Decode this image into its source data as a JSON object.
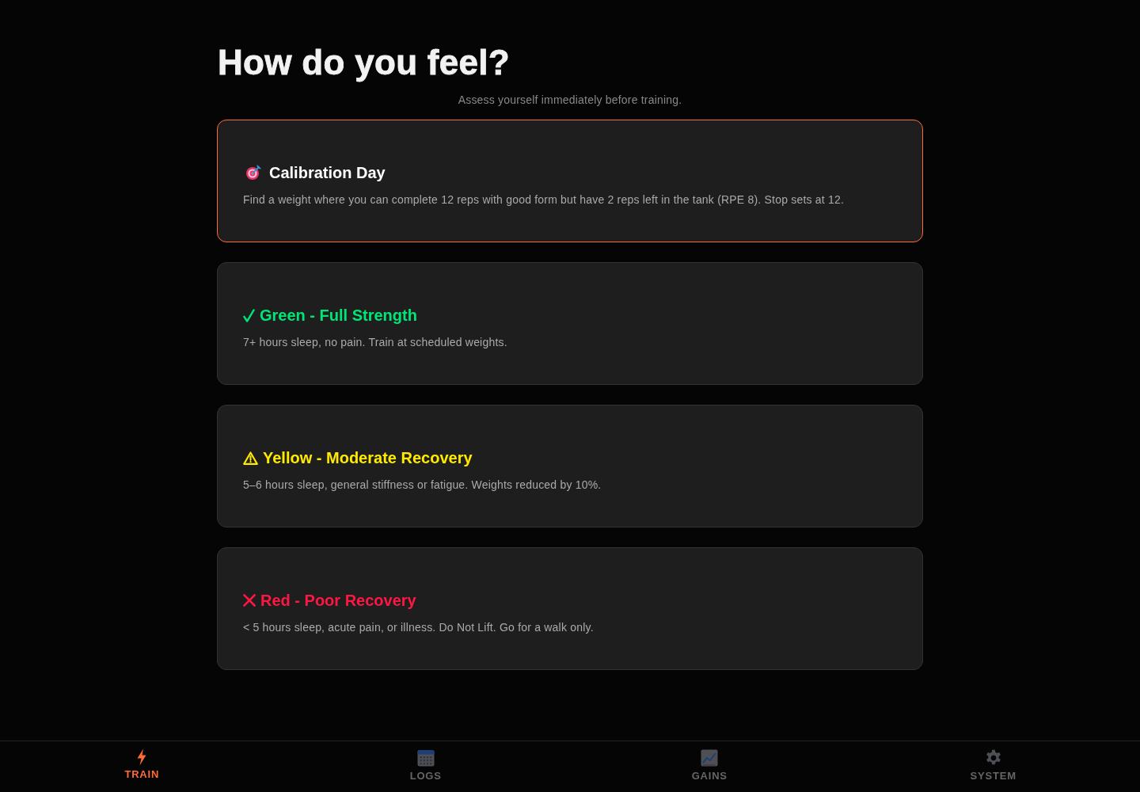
{
  "header": {
    "title": "How do you feel?",
    "subtitle": "Assess yourself immediately before training."
  },
  "cards": [
    {
      "kind": "calibration",
      "selected": true,
      "title": "Calibration Day",
      "color": "#ffffff",
      "description": "Find a weight where you can complete 12 reps with good form but have 2 reps left in the tank (RPE 8). Stop sets at 12."
    },
    {
      "kind": "go",
      "selected": false,
      "title": "Green - Full Strength",
      "color": "#00e676",
      "description": "7+ hours sleep, no pain. Train at scheduled weights."
    },
    {
      "kind": "caution",
      "selected": false,
      "title": "Yellow - Moderate Recovery",
      "color": "#ffea00",
      "description": "5–6 hours sleep, general stiffness or fatigue. Weights reduced by 10%."
    },
    {
      "kind": "stop",
      "selected": false,
      "title": "Red - Poor Recovery",
      "color": "#ff1744",
      "description": "< 5 hours sleep, acute pain, or illness. Do Not Lift. Go for a walk only."
    }
  ],
  "nav": [
    {
      "label": "TRAIN",
      "selected": true
    },
    {
      "label": "LOGS",
      "selected": false
    },
    {
      "label": "GAINS",
      "selected": false
    },
    {
      "label": "SYSTEM",
      "selected": false
    }
  ]
}
